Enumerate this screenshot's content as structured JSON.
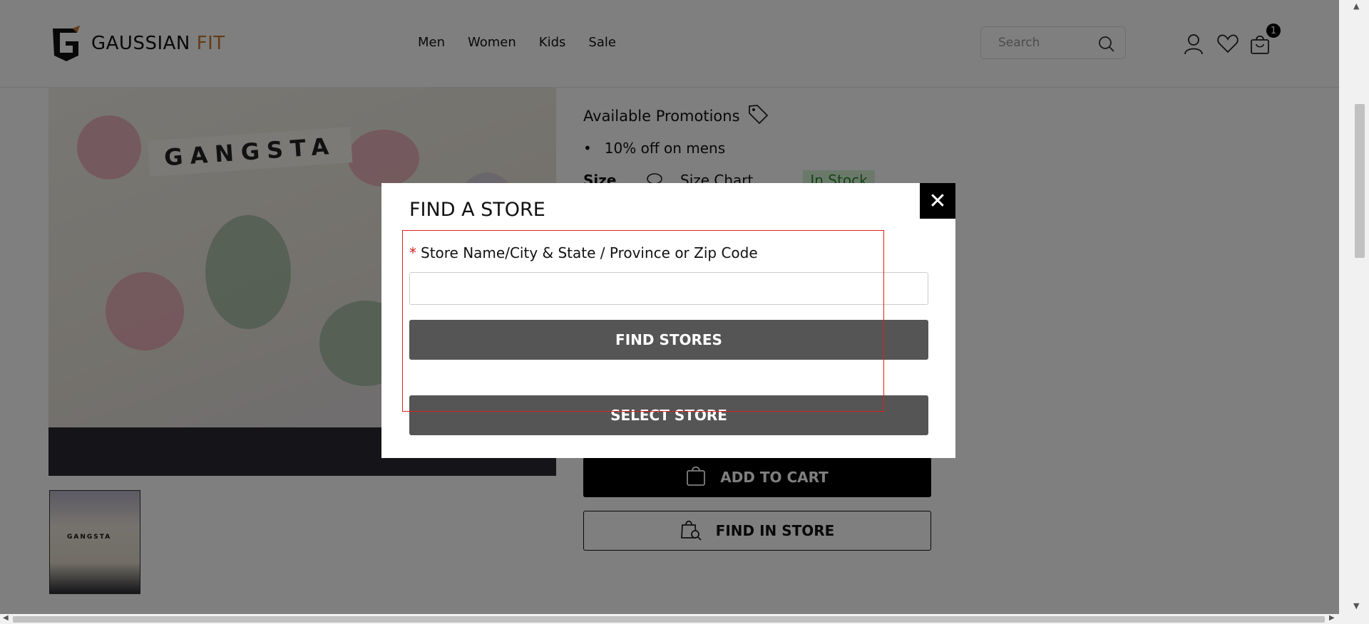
{
  "header": {
    "logo_main": "GAUSSIAN",
    "logo_accent": "FIT",
    "nav": [
      "Men",
      "Women",
      "Kids",
      "Sale"
    ],
    "search_placeholder": "Search",
    "cart_count": "1",
    "icons": [
      "user-icon",
      "heart-icon",
      "cart-icon",
      "search-icon"
    ]
  },
  "product": {
    "image_text": "GANGSTA",
    "thumbnail_text": "GANGSTA",
    "promotions_title": "Available Promotions",
    "promotions": [
      "10% off on mens"
    ],
    "size_label": "Size",
    "size_chart_label": "Size Chart",
    "stock_status": "In Stock",
    "add_to_cart": "ADD TO CART",
    "find_in_store": "FIND IN STORE"
  },
  "modal": {
    "title": "FIND A STORE",
    "required_mark": "*",
    "field_label": "Store Name/City & State / Province or Zip Code",
    "field_value": "",
    "find_button": "FIND STORES",
    "select_button": "SELECT STORE",
    "close_symbol": "✕"
  },
  "colors": {
    "accent": "#c8792b",
    "modal_button": "#555555",
    "required": "#d32020",
    "in_stock_bg": "#d6f2d6",
    "highlight": "#e02020"
  }
}
